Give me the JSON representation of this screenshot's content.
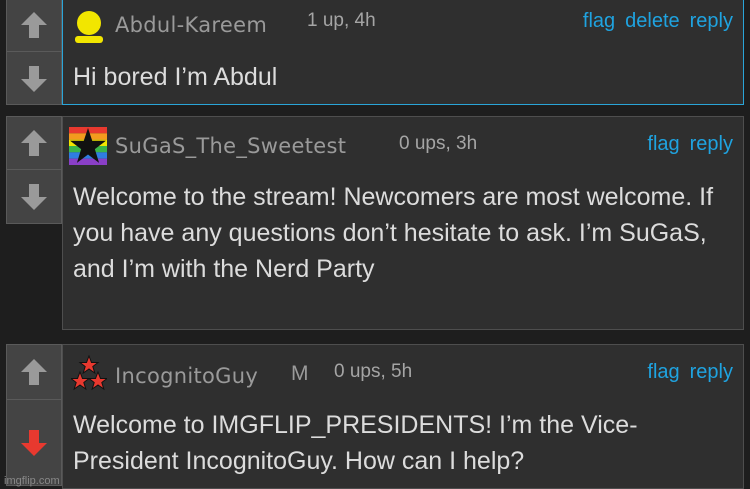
{
  "comments": [
    {
      "username": "Abdul-Kareem",
      "meta": "1 up, 4h",
      "actions": [
        "flag",
        "delete",
        "reply"
      ],
      "text": "Hi bored I’m Abdul",
      "avatar_icon": "yellow-person-icon",
      "downvoted": false
    },
    {
      "username": "SuGaS_The_Sweetest",
      "meta": "0 ups, 3h",
      "actions": [
        "flag",
        "reply"
      ],
      "text": "Welcome to the stream! Newcomers are most welcome. If you have any questions don’t hesitate to ask. I’m SuGaS, and I’m with the Nerd Party",
      "avatar_icon": "rainbow-star-icon",
      "downvoted": false
    },
    {
      "username": "IncognitoGuy",
      "mod_badge": "M",
      "meta": "0 ups, 5h",
      "actions": [
        "flag",
        "reply"
      ],
      "text": "Welcome to IMGFLIP_PRESIDENTS! I’m the Vice-President IncognitoGuy. How can I help?",
      "avatar_icon": "stars-icon",
      "downvoted": true
    }
  ],
  "watermark": "imgflip.com",
  "colors": {
    "link": "#1fa3e0",
    "downvote_active": "#e8392f",
    "arrow_inactive": "#9a9a9a"
  }
}
